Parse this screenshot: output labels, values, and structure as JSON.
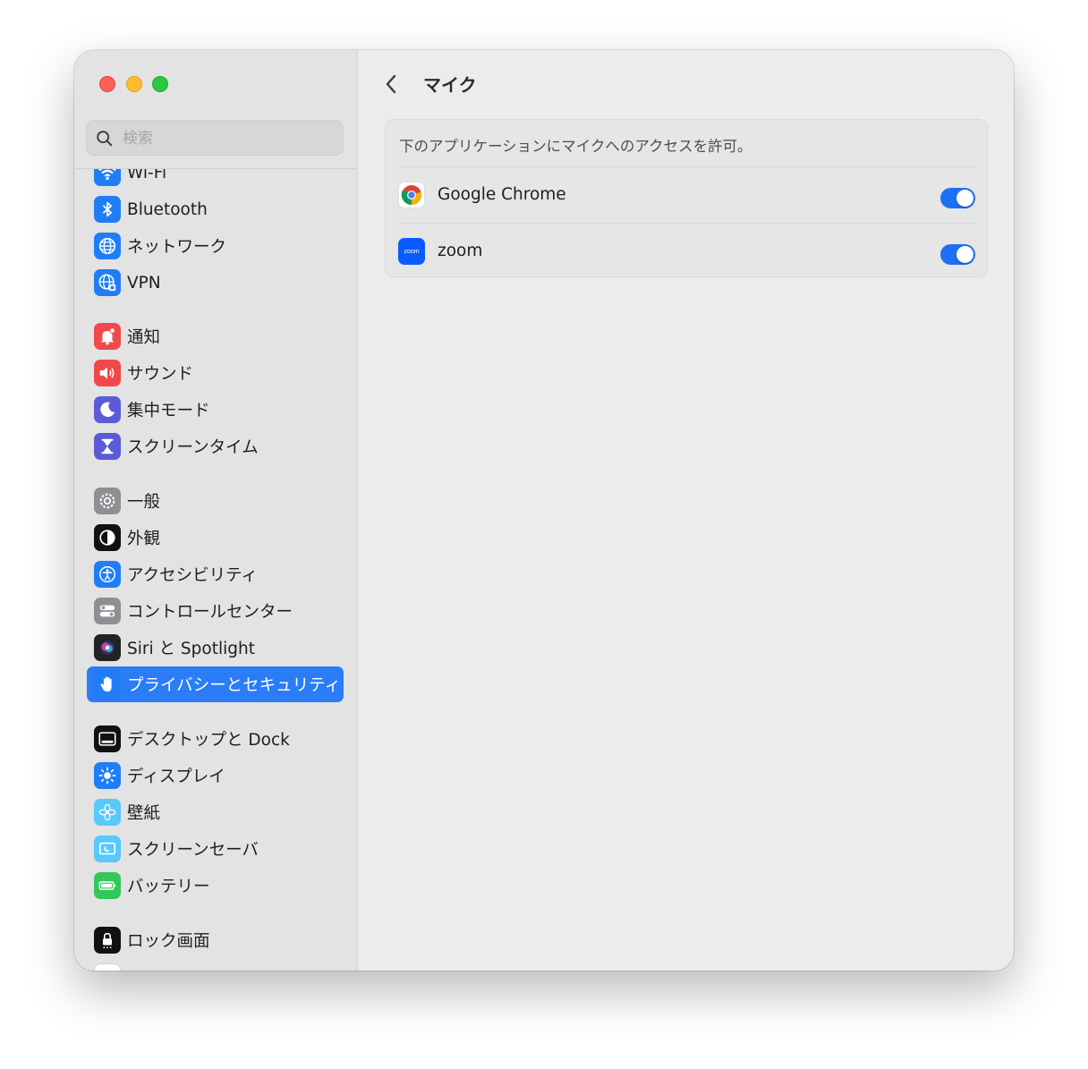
{
  "window": {
    "title": "マイク"
  },
  "search": {
    "placeholder": "検索",
    "value": ""
  },
  "sidebar": {
    "items": [
      {
        "label": "Wi-Fi",
        "icon": "wifi-icon",
        "color": "#1f7ef5"
      },
      {
        "label": "Bluetooth",
        "icon": "bluetooth-icon",
        "color": "#1f7ef5"
      },
      {
        "label": "ネットワーク",
        "icon": "globe-icon",
        "color": "#1f7ef5"
      },
      {
        "label": "VPN",
        "icon": "vpn-globe-icon",
        "color": "#1f7ef5"
      },
      {
        "label": "通知",
        "icon": "bell-icon",
        "color": "#f0494d"
      },
      {
        "label": "サウンド",
        "icon": "speaker-icon",
        "color": "#f0494d"
      },
      {
        "label": "集中モード",
        "icon": "moon-icon",
        "color": "#5b5bd6"
      },
      {
        "label": "スクリーンタイム",
        "icon": "hourglass-icon",
        "color": "#5b5bd6"
      },
      {
        "label": "一般",
        "icon": "gear-icon",
        "color": "#8e8e93"
      },
      {
        "label": "外観",
        "icon": "appearance-icon",
        "color": "#111111"
      },
      {
        "label": "アクセシビリティ",
        "icon": "accessibility-icon",
        "color": "#1f7ef5"
      },
      {
        "label": "コントロールセンター",
        "icon": "toggles-icon",
        "color": "#8e8e93"
      },
      {
        "label": "Siri と Spotlight",
        "icon": "siri-icon",
        "color": "#222222"
      },
      {
        "label": "プライバシーとセキュリティ",
        "icon": "hand-icon",
        "color": "#1f7ef5",
        "selected": true
      },
      {
        "label": "デスクトップと Dock",
        "icon": "dock-icon",
        "color": "#111111"
      },
      {
        "label": "ディスプレイ",
        "icon": "sun-icon",
        "color": "#1f7ef5"
      },
      {
        "label": "壁紙",
        "icon": "flower-icon",
        "color": "#5ac8fa"
      },
      {
        "label": "スクリーンセーバ",
        "icon": "screensaver-icon",
        "color": "#5ac8fa"
      },
      {
        "label": "バッテリー",
        "icon": "battery-icon",
        "color": "#34c759"
      },
      {
        "label": "ロック画面",
        "icon": "lock-icon",
        "color": "#111111"
      },
      {
        "label": "",
        "icon": "touch-id-icon",
        "color": "#f0494d"
      }
    ]
  },
  "main": {
    "description": "下のアプリケーションにマイクへのアクセスを許可。",
    "apps": [
      {
        "name": "Google Chrome",
        "icon": "chrome-icon",
        "enabled": true
      },
      {
        "name": "zoom",
        "icon": "zoom-icon",
        "icon_text": "zoom",
        "enabled": true
      }
    ]
  },
  "colors": {
    "accent": "#1d6ff3",
    "selection": "#2a7cf7"
  }
}
